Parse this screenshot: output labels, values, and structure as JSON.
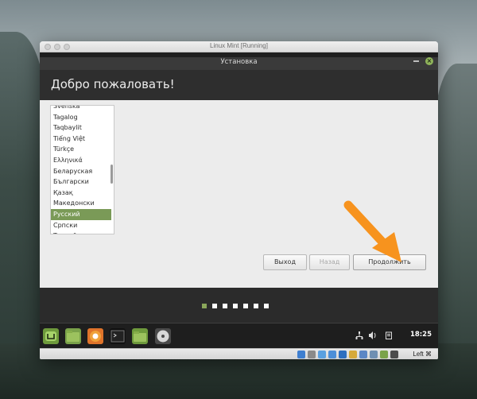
{
  "vbox": {
    "title": "Linux Mint [Running]",
    "host_key": "Left ⌘"
  },
  "installer": {
    "window_title": "Установка",
    "heading": "Добро пожаловать!",
    "languages": [
      "Svenska",
      "Tagalog",
      "Taqbaylit",
      "Tiếng Việt",
      "Türkçe",
      "Ελληνικά",
      "Беларуская",
      "Български",
      "Қазақ",
      "Македонски",
      "Русский",
      "Српски",
      "Точикӣ"
    ],
    "selected_language": "Русский",
    "buttons": {
      "quit": "Выход",
      "back": "Назад",
      "continue": "Продолжить"
    },
    "progress": {
      "total_steps": 7,
      "current_step": 1
    }
  },
  "panel": {
    "clock": "18:25",
    "launchers": [
      "mint-menu-icon",
      "files-icon",
      "firefox-icon",
      "terminal-icon",
      "folder-icon",
      "disc-icon"
    ]
  },
  "colors": {
    "accent": "#7a9a57",
    "arrow": "#f7931e"
  }
}
